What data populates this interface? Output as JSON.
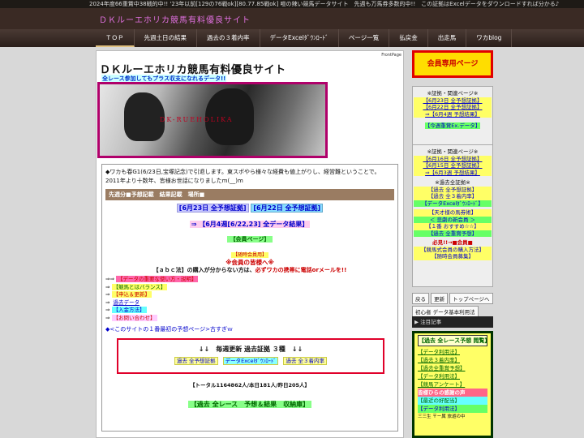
{
  "topbar": {
    "text": "2024年度66重賞中38戦的中!! '23年以前[129の76戦ok][80.77.85戦ok] 喧の辣い競馬データサイト　先週も万馬券多数的中!!　この証拠はExcelデータをダウンロードすれば分かる♪"
  },
  "site": {
    "banner_title": "ＤＫルーエホリカ競馬有料優良サイト"
  },
  "nav": {
    "items": [
      "ＴＯＰ",
      "先週土日の結果",
      "過去の３着内率",
      "データExcelﾀﾞｳﾝﾛｰﾄﾞ",
      "ページ一覧",
      "払戻金",
      "出走馬",
      "ワカblog"
    ]
  },
  "main": {
    "frontpage": "FrontPage",
    "title": "ＤＫルーエホリカ競馬有料優良サイト",
    "subtitle": "全レース参加してもプラス収支になれるデータ!!",
    "hero_logo": "DK-RUEHOLIKA",
    "intro": "◆ワカも春G1(6/23日,宝塚記念)で引退します。東スポやら様々な経費も値上がりし、経営難ということで。2011年より十数年、皆様お世話になりましたm(__)m",
    "section_header": "先週分■予想記載　結果記載　場所■",
    "proof_links": [
      "[6月23日 全予想証拠]",
      "[6月22日 全予想証拠]"
    ],
    "result_link": "⇒ 【6月4週[6/22,23] 全データ結果】",
    "member_page": "【会員ページ】",
    "recruit": "【随時会員用】",
    "member_notice": "※会員の皆様へ※",
    "abc_line1": "【ａｂｃ法】の購入が分からない方は、",
    "abc_line2": "必ずワカの携帯に電話orメールを!!",
    "list_items": [
      {
        "prefix": "⇒⇒",
        "label": "【データの重要な使い方・説明】"
      },
      {
        "prefix": "⇒",
        "label": "【競馬とはバランス】"
      },
      {
        "prefix": "⇒",
        "label": "【申込＆更新】"
      },
      {
        "prefix": "⇒",
        "label": "過去データ"
      },
      {
        "prefix": "⇒",
        "label": "【入金方法】"
      },
      {
        "prefix": "⇒",
        "label": "【お問い合わせ】"
      }
    ],
    "first_prediction": "◆<このサイトの１番最初の予想ページ>古すぎｗ",
    "update_box": {
      "heading": "↓↓　毎週更新 過去証拠 ３種　↓↓",
      "links": [
        "過去 全予想証拠",
        "データExcelﾀﾞｳﾝﾛｰﾄﾞ",
        "過去 全３着内率"
      ]
    },
    "total": "【トータル1164862人/本日181人/昨日205人】",
    "last_heading": "【過去 全レース　予想＆結果　収納庫】"
  },
  "right": {
    "vip": "会員専用ページ",
    "panel1": {
      "title": "※証拠・関連ページ※",
      "links": [
        "【6月23日 全予想証拠】",
        "【6月22日 全予想証拠】",
        "⇒【6月4週 予想結果】"
      ],
      "extra": "【今週重賞Ex.データ】"
    },
    "panel2": {
      "title": "※証拠・関連ページ※",
      "links": [
        "【6月16日 全予想証拠】",
        "【6月15日 全予想証拠】",
        "⇒【6月3週 予想結果】"
      ],
      "past_title": "※過去全証拠※",
      "past_links": [
        "【過去 全予想証拠】",
        "【過去 全３着内率】",
        "【データExcelﾀﾞｳﾝﾛｰﾄﾞ】"
      ],
      "misc": [
        "【天才様の馬券術】",
        "＜ 悲劇の新会員 ＞",
        "【１番 おすすめ☆☆】",
        "【過去 全重賞予想】"
      ],
      "must": "必見!!→■会員■",
      "how": "【競馬式会員の購入方法】",
      "recruit": "【随時会員募集】"
    },
    "buttons": [
      "戻る",
      "更新",
      "トップページへ",
      "初心者 データ基本利用法"
    ],
    "note": "▶ 注目記事",
    "bottom": {
      "heading": "【過去 全レース予想 閲覧】",
      "items": [
        "【データ利用法】",
        "【過去３着内率】",
        "【過去全重賞予想】",
        "【データ利用法】",
        "【競馬アンケート】"
      ],
      "red": "皆様ひらの感謝の声",
      "cyan": "【最近の好配当】",
      "green": "【データ利用法】",
      "last": "三三生 〒ー属 旅遊の中"
    }
  }
}
